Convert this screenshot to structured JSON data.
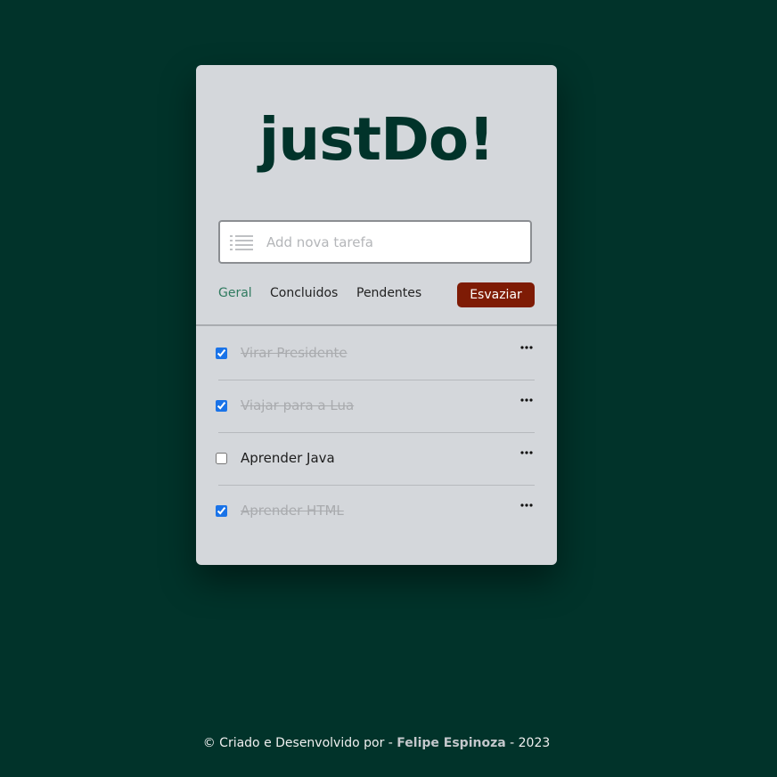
{
  "app": {
    "logo": "justDo!"
  },
  "input": {
    "placeholder": "Add nova tarefa",
    "icon": "list-icon"
  },
  "tabs": [
    {
      "label": "Geral",
      "active": true
    },
    {
      "label": "Concluidos",
      "active": false
    },
    {
      "label": "Pendentes",
      "active": false
    }
  ],
  "clear_button": {
    "label": "Esvaziar"
  },
  "tasks": [
    {
      "label": "Virar Presidente",
      "done": true
    },
    {
      "label": "Viajar para a Lua",
      "done": true
    },
    {
      "label": "Aprender Java",
      "done": false
    },
    {
      "label": "Aprender HTML",
      "done": true
    }
  ],
  "footer": {
    "prefix": "© Criado e Desenvolvido por -",
    "author": "Felipe Espinoza",
    "suffix": "- 2023"
  },
  "colors": {
    "background": "#01332a",
    "card": "#d4d7db",
    "logo": "#01332a",
    "active_tab": "#2f7a5f",
    "clear_button": "#7e1b05"
  }
}
